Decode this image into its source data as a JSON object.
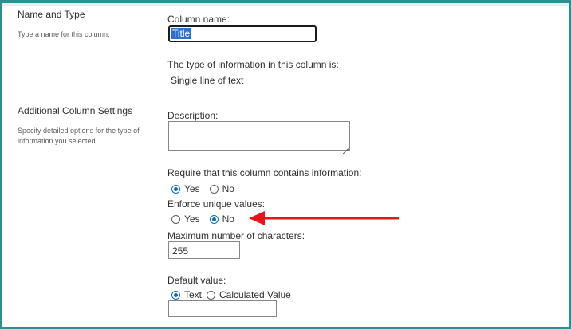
{
  "name_type": {
    "title": "Name and Type",
    "description": "Type a name for this column.",
    "column_name_label": "Column name:",
    "column_name_value": "Title",
    "type_info_label": "The type of information in this column is:",
    "type_value": "Single line of text"
  },
  "additional": {
    "title": "Additional Column Settings",
    "description_line1": "Specify detailed options for the type of",
    "description_line2": "information you selected.",
    "description_label": "Description:",
    "description_value": "",
    "require_label": "Require that this column contains information:",
    "require_yes": "Yes",
    "require_no": "No",
    "require_selected": "Yes",
    "unique_label": "Enforce unique values:",
    "unique_yes": "Yes",
    "unique_no": "No",
    "unique_selected": "No",
    "maxchars_label": "Maximum number of characters:",
    "maxchars_value": "255",
    "default_label": "Default value:",
    "default_text": "Text",
    "default_calculated": "Calculated Value",
    "default_selected": "Text",
    "default_value": ""
  },
  "colors": {
    "frame": "#2f8f8f",
    "annotation_arrow": "#e8141b",
    "radio_accent": "#0f6cbd",
    "selection": "#2f6fcf"
  }
}
